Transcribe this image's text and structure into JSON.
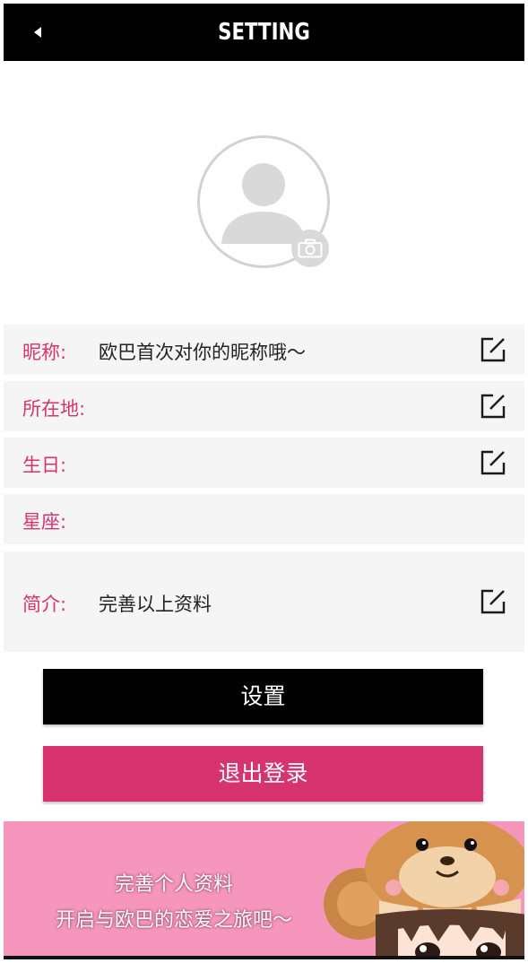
{
  "header": {
    "title": "SETTING",
    "back_icon": "back-arrow-icon"
  },
  "avatar": {
    "placeholder_icon": "user-silhouette-icon",
    "camera_icon": "camera-icon"
  },
  "fields": {
    "nickname": {
      "label": "昵称:",
      "value": "欧巴首次对你的昵称哦～"
    },
    "location": {
      "label": "所在地:",
      "value": ""
    },
    "birthday": {
      "label": "生日:",
      "value": ""
    },
    "constellation": {
      "label": "星座:",
      "value": ""
    },
    "intro": {
      "label": "简介:",
      "value": "完善以上资料"
    }
  },
  "buttons": {
    "settings_label": "设置",
    "logout_label": "退出登录"
  },
  "banner": {
    "line1": "完善个人资料",
    "line2": "开启与欧巴的恋爱之旅吧～"
  },
  "colors": {
    "accent": "#d6336f",
    "header_bg": "#000000",
    "logout_bg": "#d6336f",
    "banner_bg": "#f696bc",
    "row_bg": "#f5f5f5"
  }
}
